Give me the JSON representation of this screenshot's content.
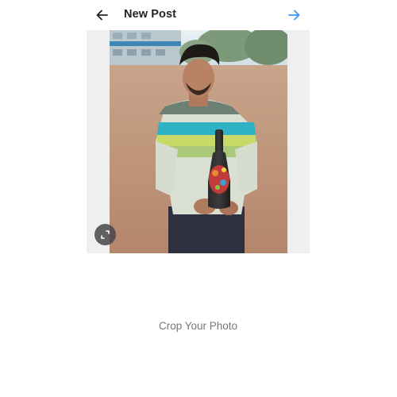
{
  "header": {
    "title": "New Post",
    "back_icon": "arrow-left-icon",
    "next_icon": "arrow-right-icon"
  },
  "crop": {
    "hint": "Crop Your Photo",
    "expand_icon": "expand-icon",
    "photo_subject": "man-holding-bottle-photo"
  },
  "colors": {
    "accent": "#3897f0",
    "title": "#222222",
    "hint": "#777777",
    "crop_background": "#efefef"
  }
}
